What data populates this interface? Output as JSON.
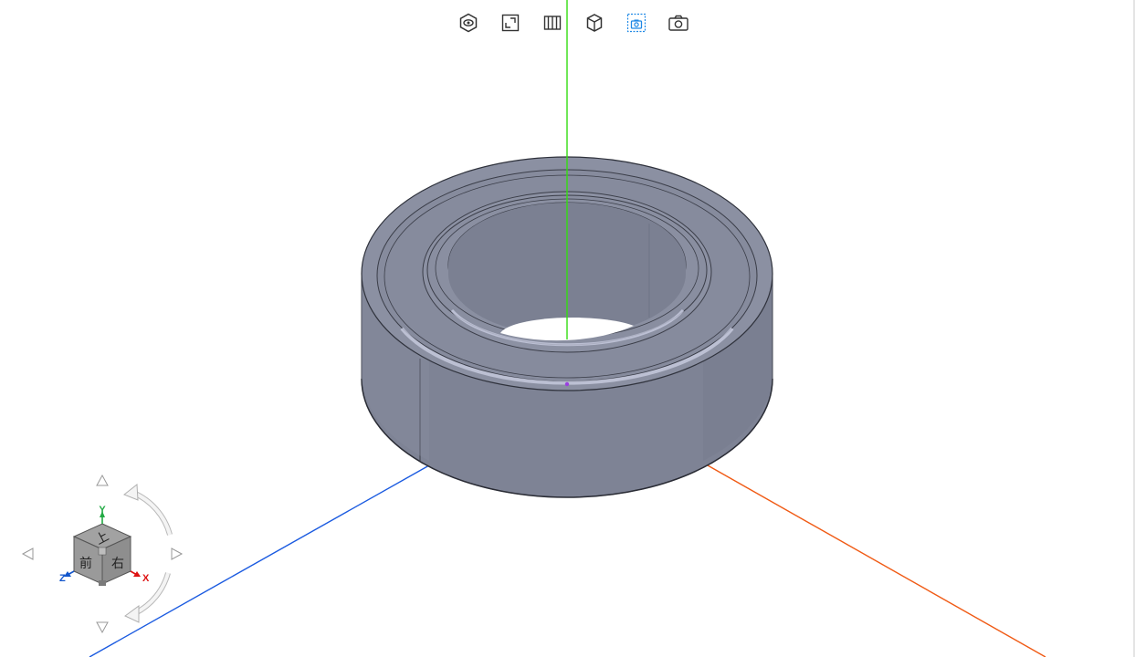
{
  "toolbar": {
    "buttons": [
      {
        "name": "view-mode-button",
        "icon": "eye-hexagon-icon"
      },
      {
        "name": "fit-view-button",
        "icon": "expand-corners-icon"
      },
      {
        "name": "section-view-button",
        "icon": "columns-icon"
      },
      {
        "name": "cube-view-button",
        "icon": "cube-icon"
      },
      {
        "name": "screenshot-region-button",
        "icon": "camera-dashed-frame-icon",
        "active": true
      },
      {
        "name": "screenshot-button",
        "icon": "camera-icon"
      }
    ],
    "active_color": "#1e88e5",
    "icon_color": "#333333"
  },
  "axes": {
    "x_color": "#f05a14",
    "y_color": "#33dd11",
    "z_color": "#1a5ae0"
  },
  "model": {
    "body_color": "#7f8496",
    "top_color": "#8a8fa1",
    "highlight_color": "#c8cce0"
  },
  "view_cube": {
    "top_face": "上",
    "front_face": "前",
    "right_face": "右",
    "axis_x": "X",
    "axis_y": "Y",
    "axis_z": "Z",
    "x_color": "#dd1111",
    "y_color": "#22aa44",
    "z_color": "#1155cc"
  }
}
